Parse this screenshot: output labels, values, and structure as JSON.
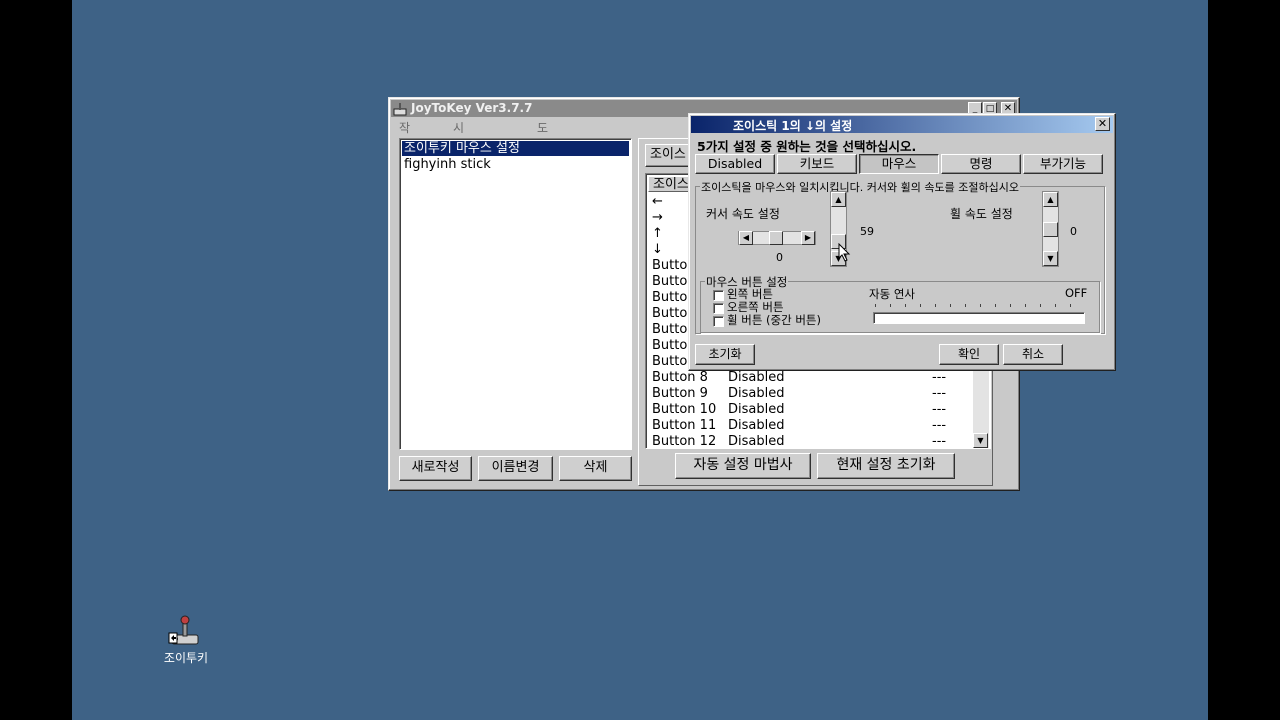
{
  "desktop": {
    "icon_label": "조이투키"
  },
  "main_window": {
    "title": "JoyToKey Ver3.7.7",
    "menu": [
      "작성(F)",
      "시작 설정(S)",
      "도움말(H)"
    ],
    "profiles": [
      "조이투키 마우스 설정",
      "fighyinh stick"
    ],
    "new_button": "새로작성",
    "rename_button": "이름변경",
    "delete_button": "삭제",
    "tab_label": "조이스",
    "column_header": "조이스",
    "wizard_button": "자동 설정 마법사",
    "reset_button": "현재 설정 초기화",
    "rows": [
      {
        "key": "←",
        "value": "",
        "extra": ""
      },
      {
        "key": "→",
        "value": "",
        "extra": ""
      },
      {
        "key": "↑",
        "value": "",
        "extra": ""
      },
      {
        "key": "↓",
        "value": "",
        "extra": ""
      },
      {
        "key": "Butto",
        "value": "",
        "extra": ""
      },
      {
        "key": "Butto",
        "value": "",
        "extra": ""
      },
      {
        "key": "Butto",
        "value": "",
        "extra": ""
      },
      {
        "key": "Butto",
        "value": "",
        "extra": ""
      },
      {
        "key": "Butto",
        "value": "",
        "extra": ""
      },
      {
        "key": "Butto",
        "value": "",
        "extra": ""
      },
      {
        "key": "Butto",
        "value": "",
        "extra": ""
      },
      {
        "key": "Button 8",
        "value": "Disabled",
        "extra": "---"
      },
      {
        "key": "Button 9",
        "value": "Disabled",
        "extra": "---"
      },
      {
        "key": "Button 10",
        "value": "Disabled",
        "extra": "---"
      },
      {
        "key": "Button 11",
        "value": "Disabled",
        "extra": "---"
      },
      {
        "key": "Button 12",
        "value": "Disabled",
        "extra": "---"
      }
    ]
  },
  "dialog": {
    "title": "조이스틱 1의 ↓의 설정",
    "instruction": "5가지 설정 중 원하는 것을 선택하십시오.",
    "tabs": [
      "Disabled",
      "키보드",
      "마우스",
      "명령",
      "부가기능"
    ],
    "selected_tab": "마우스",
    "mouse_group_title": "조이스틱을 마우스와 일치시킵니다. 커서와 휠의 속도를 조절하십시오",
    "cursor_speed_label": "커서 속도 설정",
    "cursor_h_value": "0",
    "cursor_v_value": "59",
    "wheel_speed_label": "휠 속도 설정",
    "wheel_value": "0",
    "button_group_title": "마우스 버튼 설정",
    "left_button": "왼쪽 버튼",
    "right_button": "오른쪽 버튼",
    "wheel_button": "휠 버튼 (중간 버튼)",
    "auto_fire_label": "자동 연사",
    "auto_fire_value": "OFF",
    "reset_button": "초기화",
    "ok_button": "확인",
    "cancel_button": "취소"
  },
  "colors": {
    "desktop": "#3e6286",
    "title_active": "#0a246a",
    "title_inactive": "#808080",
    "selection": "#0a246a"
  }
}
